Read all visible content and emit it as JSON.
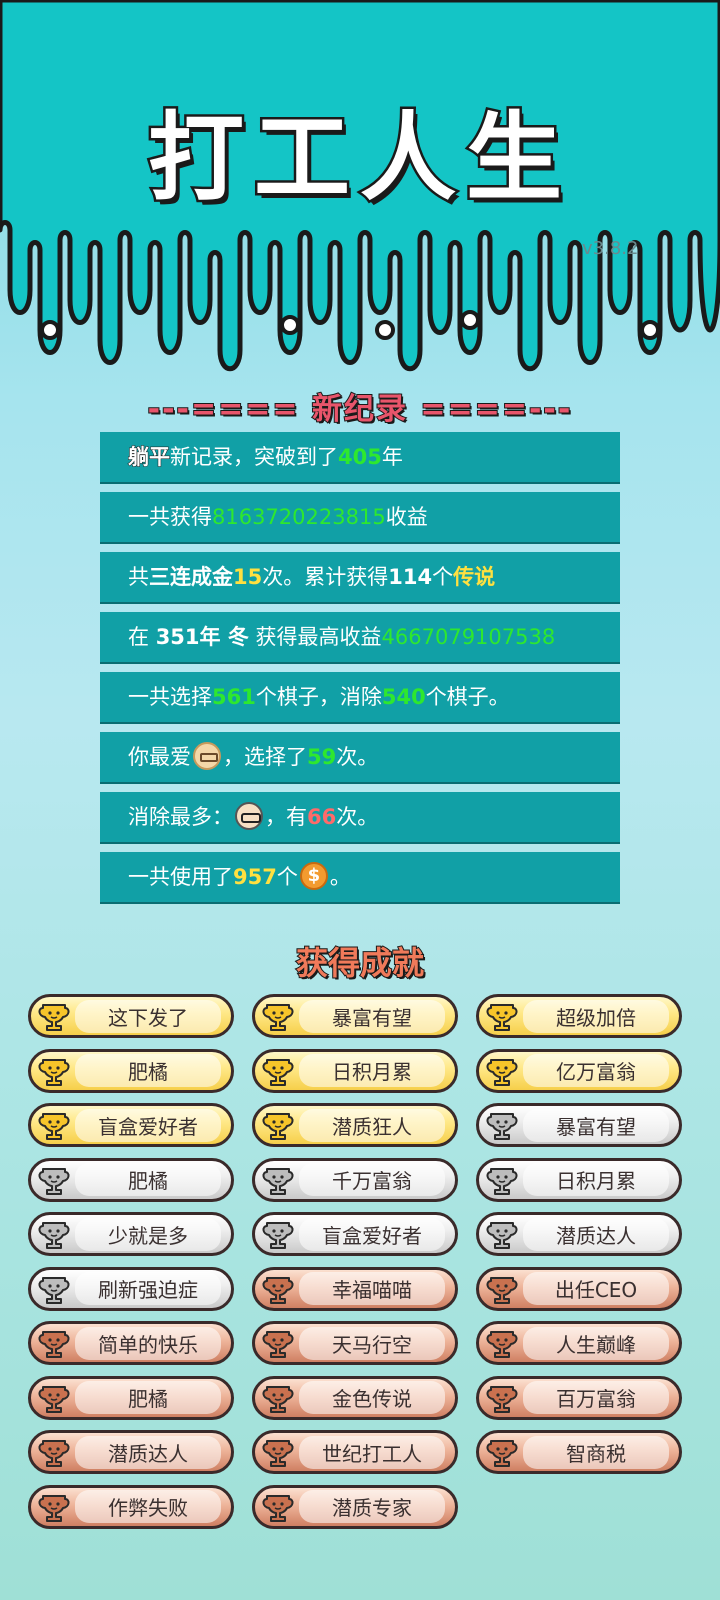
{
  "title": "打工人生",
  "version": "v3.8.2",
  "records_heading": "---==== 新纪录 ====---",
  "records": {
    "r1": {
      "a": "躺平",
      "b": "新记录，突破到了",
      "c": "405",
      "d": "年"
    },
    "r2": {
      "a": "一共获得",
      "b": "8163720223815",
      "c": "收益"
    },
    "r3": {
      "a": "共",
      "b": "三连成金",
      "c": "15",
      "d": "次。累计获得",
      "e": "114",
      "f": "个",
      "g": "传说"
    },
    "r4": {
      "a": "在",
      "b": "351年 冬",
      "c": "获得最高收益",
      "d": "4667079107538"
    },
    "r5": {
      "a": "一共选择",
      "b": "561",
      "c": "个棋子，消除",
      "d": "540",
      "e": "个棋子。"
    },
    "r6": {
      "a": "你最爱",
      "b": "，选择了",
      "c": "59",
      "d": "次。"
    },
    "r7": {
      "a": "消除最多：",
      "b": "，有",
      "c": "66",
      "d": "次。"
    },
    "r8": {
      "a": "一共使用了",
      "b": "957",
      "c": "个",
      "d": "。"
    }
  },
  "icons": {
    "face_old": "old-man-face-icon",
    "face_nerd": "glasses-man-face-icon",
    "coin": "coin-icon",
    "trophy": "trophy-icon"
  },
  "coin_symbol": "$",
  "achievements_heading": "获得成就",
  "colors": {
    "gold": "#f6cf4a",
    "silver": "#c9c9c9",
    "bronze": "#cf7f62",
    "record_bg": "#11a0a6",
    "highlight_green": "#2ee82e",
    "highlight_yellow": "#ffe040",
    "highlight_red": "#ff6a6a"
  },
  "achievements": [
    {
      "label": "这下发了",
      "tier": "gold"
    },
    {
      "label": "暴富有望",
      "tier": "gold"
    },
    {
      "label": "超级加倍",
      "tier": "gold"
    },
    {
      "label": "肥橘",
      "tier": "gold"
    },
    {
      "label": "日积月累",
      "tier": "gold"
    },
    {
      "label": "亿万富翁",
      "tier": "gold"
    },
    {
      "label": "盲盒爱好者",
      "tier": "gold"
    },
    {
      "label": "潜质狂人",
      "tier": "gold"
    },
    {
      "label": "暴富有望",
      "tier": "silver"
    },
    {
      "label": "肥橘",
      "tier": "silver"
    },
    {
      "label": "千万富翁",
      "tier": "silver"
    },
    {
      "label": "日积月累",
      "tier": "silver"
    },
    {
      "label": "少就是多",
      "tier": "silver"
    },
    {
      "label": "盲盒爱好者",
      "tier": "silver"
    },
    {
      "label": "潜质达人",
      "tier": "silver"
    },
    {
      "label": "刷新强迫症",
      "tier": "silver"
    },
    {
      "label": "幸福喵喵",
      "tier": "bronze"
    },
    {
      "label": "出任CEO",
      "tier": "bronze"
    },
    {
      "label": "简单的快乐",
      "tier": "bronze"
    },
    {
      "label": "天马行空",
      "tier": "bronze"
    },
    {
      "label": "人生巅峰",
      "tier": "bronze"
    },
    {
      "label": "肥橘",
      "tier": "bronze"
    },
    {
      "label": "金色传说",
      "tier": "bronze"
    },
    {
      "label": "百万富翁",
      "tier": "bronze"
    },
    {
      "label": "潜质达人",
      "tier": "bronze"
    },
    {
      "label": "世纪打工人",
      "tier": "bronze"
    },
    {
      "label": "智商税",
      "tier": "bronze"
    },
    {
      "label": "作弊失败",
      "tier": "bronze"
    },
    {
      "label": "潜质专家",
      "tier": "bronze"
    }
  ]
}
